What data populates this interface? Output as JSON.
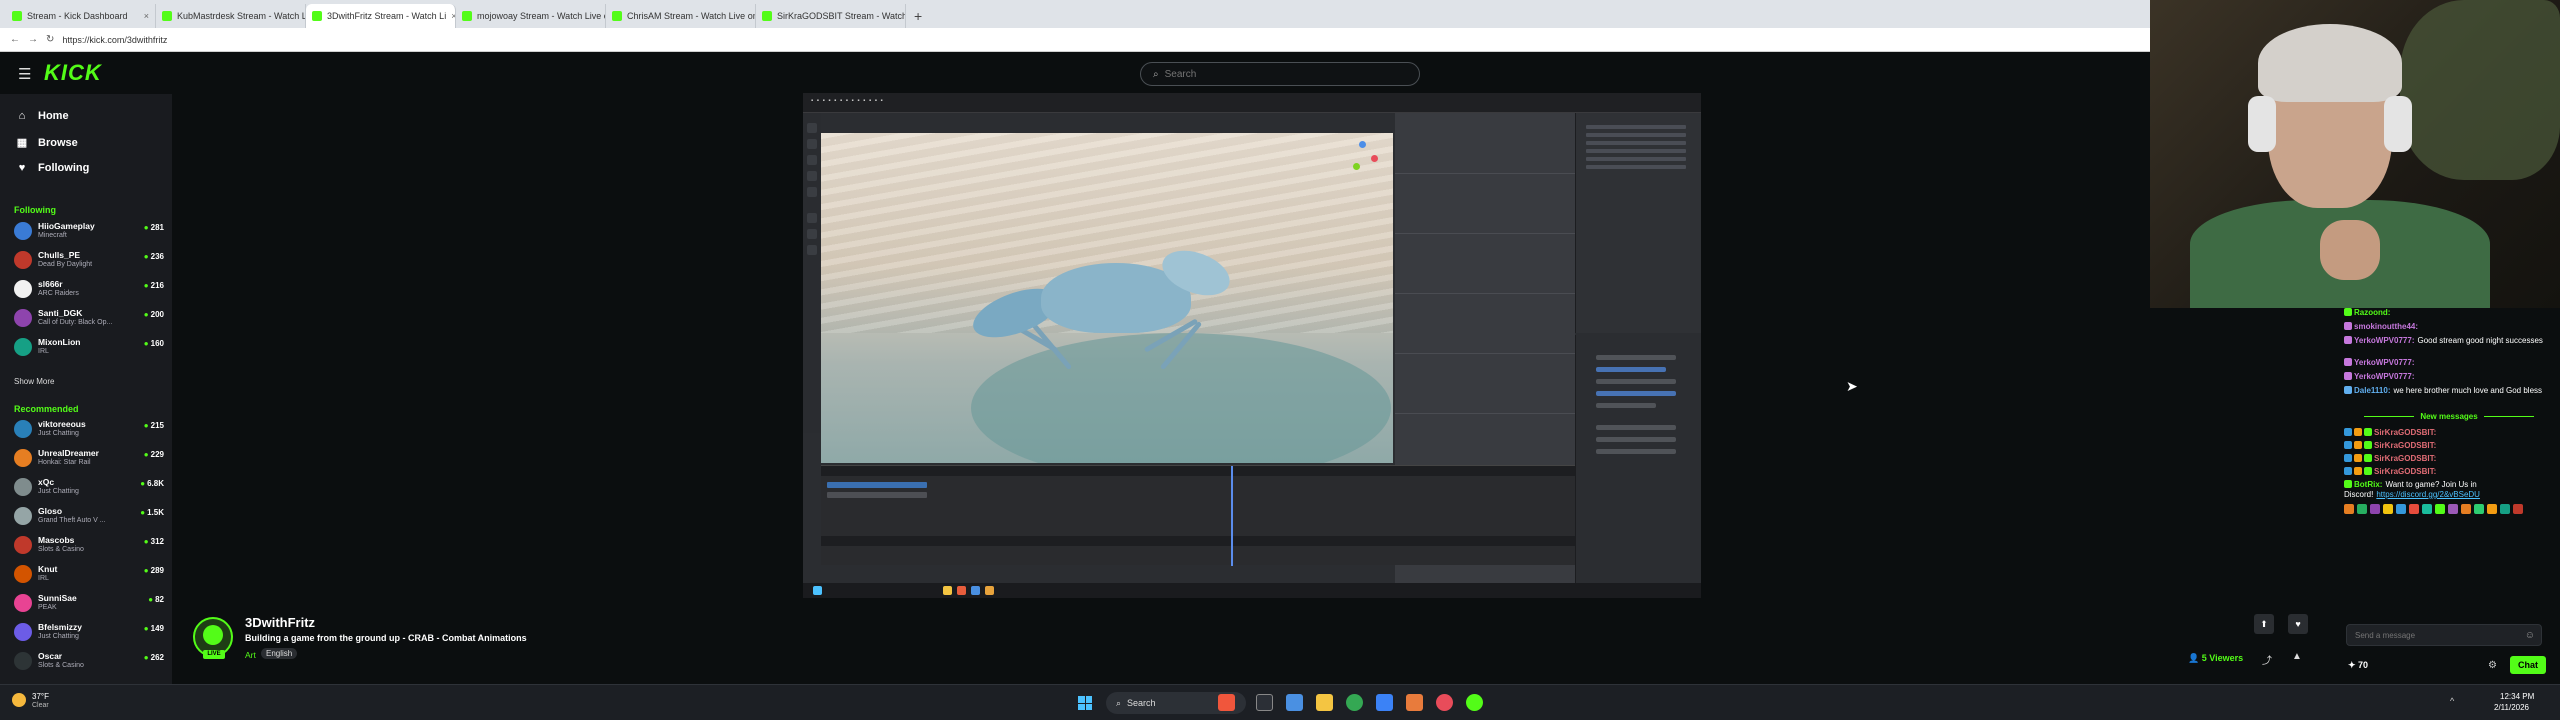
{
  "browser": {
    "tabs": [
      {
        "label": "Stream - Kick Dashboard",
        "active": false
      },
      {
        "label": "KubMastrdesk Stream - Watch Li",
        "active": false
      },
      {
        "label": "3DwithFritz Stream - Watch Li",
        "active": true
      },
      {
        "label": "mojowoay Stream - Watch Live o",
        "active": false
      },
      {
        "label": "ChrisAM Stream - Watch Live on K",
        "active": false
      },
      {
        "label": "SirKraGODSBIT Stream - Watch Li",
        "active": false
      }
    ],
    "new_tab": "+",
    "url": "https://kick.com/3dwithfritz"
  },
  "header": {
    "logo": "KICK",
    "search_placeholder": "Search"
  },
  "sidebar": {
    "nav": [
      {
        "label": "Home",
        "icon": "home-icon",
        "glyph": "⌂"
      },
      {
        "label": "Browse",
        "icon": "browse-icon",
        "glyph": "▦"
      },
      {
        "label": "Following",
        "icon": "heart-icon",
        "glyph": "♥"
      }
    ],
    "following_title": "Following",
    "following": [
      {
        "name": "HiioGameplay",
        "category": "Minecraft",
        "viewers": "281",
        "color": "#3a7bd5"
      },
      {
        "name": "Chulls_PE",
        "category": "Dead By Daylight",
        "viewers": "236",
        "color": "#c0392b"
      },
      {
        "name": "sl666r",
        "category": "ARC Raiders",
        "viewers": "216",
        "color": "#f1f1f1"
      },
      {
        "name": "Santi_DGK",
        "category": "Call of Duty: Black Op...",
        "viewers": "200",
        "color": "#8e44ad"
      },
      {
        "name": "MixonLion",
        "category": "IRL",
        "viewers": "160",
        "color": "#16a085"
      }
    ],
    "show_more": "Show More",
    "recommended_title": "Recommended",
    "recommended": [
      {
        "name": "viktoreeous",
        "category": "Just Chatting",
        "viewers": "215",
        "color": "#2980b9"
      },
      {
        "name": "UnrealDreamer",
        "category": "Honkai: Star Rail",
        "viewers": "229",
        "color": "#e67e22"
      },
      {
        "name": "xQc",
        "category": "Just Chatting",
        "viewers": "6.8K",
        "color": "#7f8c8d"
      },
      {
        "name": "Gloso",
        "category": "Grand Theft Auto V ...",
        "viewers": "1.5K",
        "color": "#95a5a6"
      },
      {
        "name": "Mascobs",
        "category": "Slots & Casino",
        "viewers": "312",
        "color": "#c0392b"
      },
      {
        "name": "Knut",
        "category": "IRL",
        "viewers": "289",
        "color": "#d35400"
      },
      {
        "name": "SunniSae",
        "category": "PEAK",
        "viewers": "82",
        "color": "#e84393"
      },
      {
        "name": "Bfelsmizzy",
        "category": "Just Chatting",
        "viewers": "149",
        "color": "#6c5ce7"
      },
      {
        "name": "Oscar",
        "category": "Slots & Casino",
        "viewers": "262",
        "color": "#2d3436"
      }
    ]
  },
  "stream": {
    "streamer": "3DwithFritz",
    "title": "Building a game from the ground up - CRAB - Combat Animations",
    "category": "Art",
    "language": "English",
    "live": "LIVE",
    "viewers": "5 Viewers"
  },
  "chat": {
    "messages": [
      {
        "user": "Razoond:",
        "text": "",
        "color": "#53fc18"
      },
      {
        "user": "smokinoutthe44:",
        "text": "",
        "color": "#c678dd"
      },
      {
        "user": "YerkoWPV0777:",
        "text": "Good stream good night successes",
        "color": "#c678dd"
      },
      {
        "user": "YerkoWPV0777:",
        "text": "",
        "color": "#c678dd"
      },
      {
        "user": "YerkoWPV0777:",
        "text": "",
        "color": "#c678dd"
      },
      {
        "user": "Dale1110:",
        "text": "we here brother much love and God bless",
        "color": "#61afef"
      }
    ],
    "new_messages": "New messages",
    "spam": [
      {
        "user": "SirKraGODSBIT:",
        "color": "#e06c75"
      },
      {
        "user": "SirKraGODSBIT:",
        "color": "#e06c75"
      },
      {
        "user": "SirKraGODSBIT:",
        "color": "#e06c75"
      },
      {
        "user": "SirKraGODSBIT:",
        "color": "#e06c75"
      }
    ],
    "bot_msg": {
      "user": "BotRix:",
      "text": "Want to game? Join Us in Discord!",
      "link": "https://discord.gg/2&vBSeDU"
    },
    "input_placeholder": "Send a message",
    "points": "70",
    "send_label": "Chat"
  },
  "taskbar": {
    "weather_temp": "37°F",
    "weather_desc": "Clear",
    "search_label": "Search",
    "time": "12:34 PM",
    "date": "2/11/2026"
  },
  "colors": {
    "kick_green": "#53fc18",
    "sidebar_bg": "#191b1f",
    "page_bg": "#0b0e0f"
  }
}
